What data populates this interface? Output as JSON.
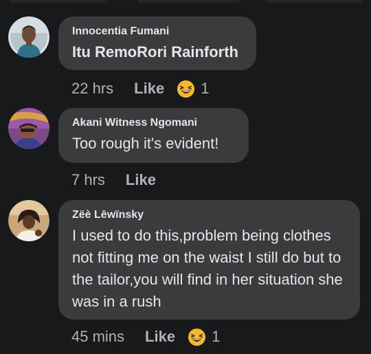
{
  "comments": [
    {
      "author": "Innocentia Fumani",
      "text": "Itu RemoRori Rainforth",
      "time": "22 hrs",
      "like_label": "Like",
      "reaction_icon": "laughing-emoji-icon",
      "reaction_count": "1"
    },
    {
      "author": "Akani Witness Ngomani",
      "text": "Too rough it's evident!",
      "time": "7 hrs",
      "like_label": "Like"
    },
    {
      "author": "Zëè Lēwïnsky",
      "text": "I used to do this,problem being clothes not fitting me on the waist I still do but to the tailor,you will find in her situation she was in a rush",
      "time": "45 mins",
      "like_label": "Like",
      "reaction_icon": "laughing-emoji-icon",
      "reaction_count": "1"
    }
  ],
  "colors": {
    "background": "#18191a",
    "bubble": "#3a3b3c",
    "text": "#e4e6eb",
    "secondary_text": "#b0b3b8",
    "emoji_face": "#f7b928"
  }
}
